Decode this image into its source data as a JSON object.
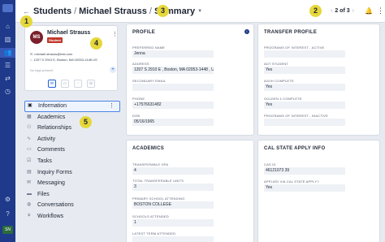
{
  "breadcrumb": {
    "section": "Students",
    "person": "Michael Strauss",
    "page": "Summary"
  },
  "pager": {
    "text": "2 of 3"
  },
  "callouts": [
    "1",
    "2",
    "3",
    "4",
    "5"
  ],
  "profile_card": {
    "initials": "MS",
    "name": "Michael Strauss",
    "tag": "Student",
    "email": "michael.strauss@test.com",
    "address": "1207 S 2910 E, Boston, MA 02053-1448 US",
    "no_tags": "No tags present"
  },
  "nav": {
    "items": [
      {
        "label": "Information",
        "icon": "info-icon"
      },
      {
        "label": "Academics",
        "icon": "grid-icon"
      },
      {
        "label": "Relationships",
        "icon": "people-icon"
      },
      {
        "label": "Activity",
        "icon": "pulse-icon"
      },
      {
        "label": "Comments",
        "icon": "comment-icon"
      },
      {
        "label": "Tasks",
        "icon": "checklist-icon"
      },
      {
        "label": "Inquiry Forms",
        "icon": "form-icon"
      },
      {
        "label": "Messaging",
        "icon": "message-icon"
      },
      {
        "label": "Files",
        "icon": "folder-icon"
      },
      {
        "label": "Conversations",
        "icon": "chat-icon"
      },
      {
        "label": "Workflows",
        "icon": "workflow-icon"
      }
    ]
  },
  "profile": {
    "title": "PROFILE",
    "fields": [
      {
        "label": "PREFERRED NAME",
        "value": "Jenna"
      },
      {
        "label": "ADDRESS",
        "value": "1207 S 2910 E , Boston, MA 02053-1448 , US"
      },
      {
        "label": "SECONDARY EMAIL",
        "value": ""
      },
      {
        "label": "PHONE",
        "value": "+17576631482"
      },
      {
        "label": "DOB",
        "value": "05/16/1965"
      }
    ]
  },
  "transfer": {
    "title": "TRANSFER PROFILE",
    "fields": [
      {
        "label": "PROGRAMS OF INTEREST - ACTIVE",
        "value": ""
      },
      {
        "label": "ADT STUDENT",
        "value": "Yes"
      },
      {
        "label": "AG/IH COMPLETE",
        "value": "Yes"
      },
      {
        "label": "GOLDEN 4 COMPLETE",
        "value": "Yes"
      },
      {
        "label": "PROGRAMS OF INTEREST - INACTIVE",
        "value": ""
      }
    ]
  },
  "academics": {
    "title": "ACADEMICS",
    "fields": [
      {
        "label": "TRANSFERABLE GPA",
        "value": "4"
      },
      {
        "label": "TOTAL TRANSFERABLE UNITS",
        "value": "3"
      },
      {
        "label": "PRIMARY SCHOOL ATTENDING",
        "value": "BOSTON COLLEGE"
      },
      {
        "label": "SCHOOLS ATTENDED",
        "value": "1"
      },
      {
        "label": "LATEST TERM ATTENDED",
        "value": ""
      }
    ]
  },
  "csu": {
    "title": "CAL STATE APPLY INFO",
    "fields": [
      {
        "label": "CAS ID",
        "value": "46121073 39"
      },
      {
        "label": "APPLIED VIA CAL STATE APPLY?",
        "value": "Yes"
      }
    ]
  }
}
